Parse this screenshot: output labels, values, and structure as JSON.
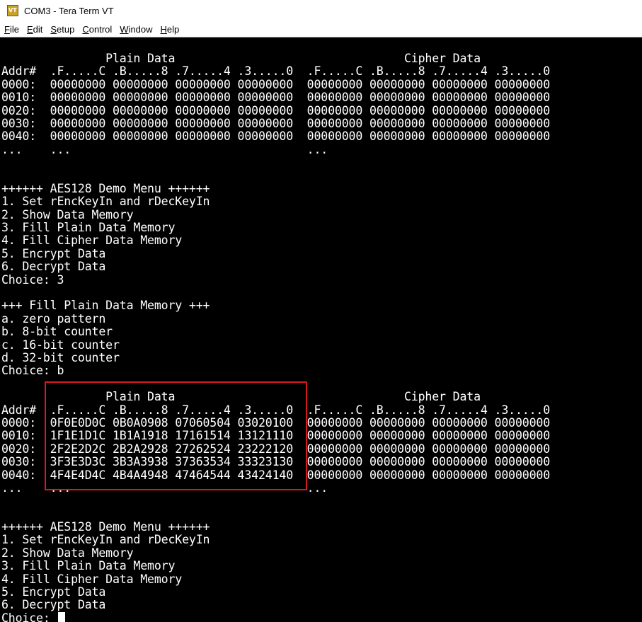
{
  "window": {
    "title": "COM3 - Tera Term VT",
    "menus": [
      {
        "label": "File",
        "underline": "F",
        "rest": "ile"
      },
      {
        "label": "Edit",
        "underline": "E",
        "rest": "dit"
      },
      {
        "label": "Setup",
        "underline": "S",
        "rest": "etup"
      },
      {
        "label": "Control",
        "underline": "C",
        "rest": "ontrol"
      },
      {
        "label": "Window",
        "underline": "W",
        "rest": "indow"
      },
      {
        "label": "Help",
        "underline": "H",
        "rest": "elp"
      }
    ]
  },
  "terminal": {
    "lines": [
      "               Plain Data                                 Cipher Data",
      "Addr#  .F.....C .B.....8 .7.....4 .3.....0  .F.....C .B.....8 .7.....4 .3.....0",
      "0000:  00000000 00000000 00000000 00000000  00000000 00000000 00000000 00000000",
      "0010:  00000000 00000000 00000000 00000000  00000000 00000000 00000000 00000000",
      "0020:  00000000 00000000 00000000 00000000  00000000 00000000 00000000 00000000",
      "0030:  00000000 00000000 00000000 00000000  00000000 00000000 00000000 00000000",
      "0040:  00000000 00000000 00000000 00000000  00000000 00000000 00000000 00000000",
      "...    ...                                  ...",
      "",
      "",
      "++++++ AES128 Demo Menu ++++++",
      "1. Set rEncKeyIn and rDecKeyIn",
      "2. Show Data Memory",
      "3. Fill Plain Data Memory",
      "4. Fill Cipher Data Memory",
      "5. Encrypt Data",
      "6. Decrypt Data",
      "Choice: 3",
      "",
      "+++ Fill Plain Data Memory +++",
      "a. zero pattern",
      "b. 8-bit counter",
      "c. 16-bit counter",
      "d. 32-bit counter",
      "Choice: b",
      "",
      "               Plain Data                                 Cipher Data",
      "Addr#  .F.....C .B.....8 .7.....4 .3.....0  .F.....C .B.....8 .7.....4 .3.....0",
      "0000:  0F0E0D0C 0B0A0908 07060504 03020100  00000000 00000000 00000000 00000000",
      "0010:  1F1E1D1C 1B1A1918 17161514 13121110  00000000 00000000 00000000 00000000",
      "0020:  2F2E2D2C 2B2A2928 27262524 23222120  00000000 00000000 00000000 00000000",
      "0030:  3F3E3D3C 3B3A3938 37363534 33323130  00000000 00000000 00000000 00000000",
      "0040:  4F4E4D4C 4B4A4948 47464544 43424140  00000000 00000000 00000000 00000000",
      "...    ...                                  ...",
      "",
      "",
      "++++++ AES128 Demo Menu ++++++",
      "1. Set rEncKeyIn and rDecKeyIn",
      "2. Show Data Memory",
      "3. Fill Plain Data Memory",
      "4. Fill Cipher Data Memory",
      "5. Encrypt Data",
      "6. Decrypt Data",
      "Choice: "
    ]
  }
}
